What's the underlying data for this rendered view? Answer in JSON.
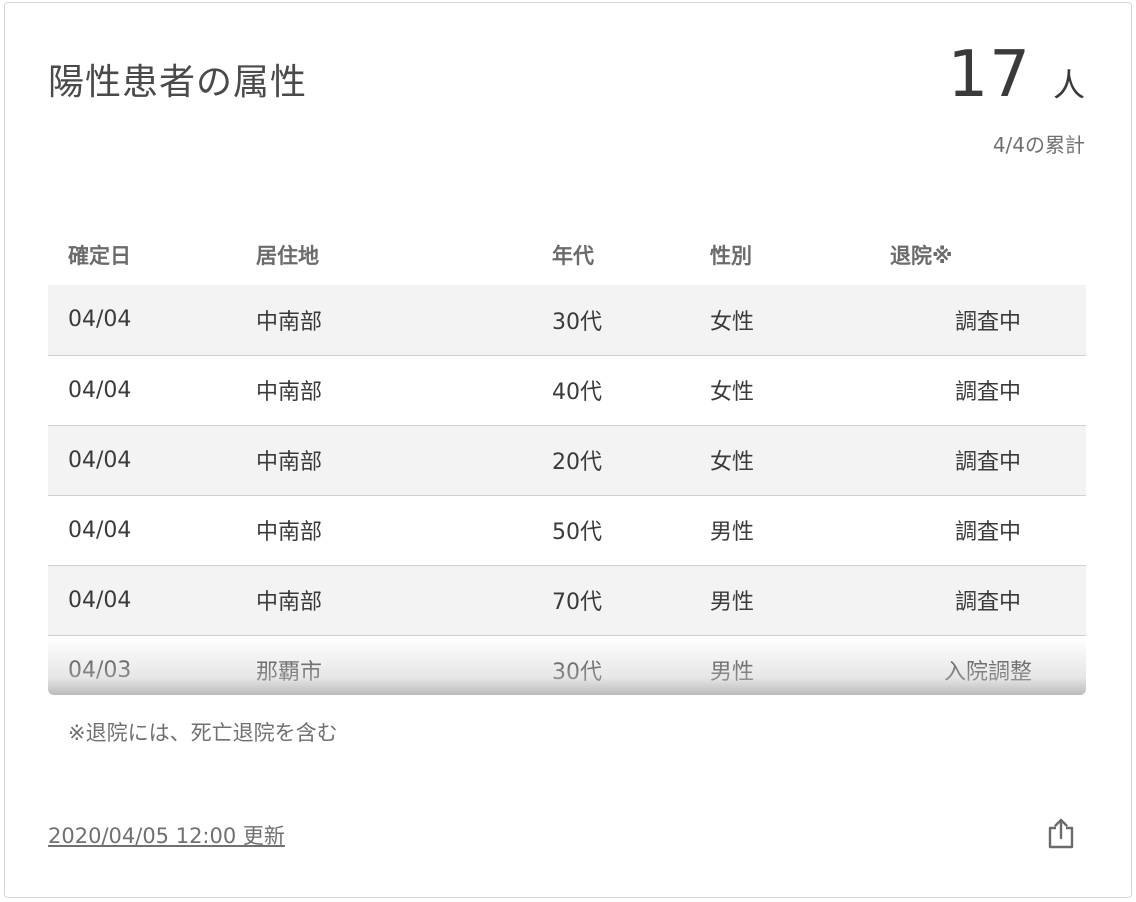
{
  "card": {
    "title": "陽性患者の属性",
    "total_value": "17",
    "total_unit": "人",
    "total_caption": "4/4の累計"
  },
  "table": {
    "headers": [
      "確定日",
      "居住地",
      "年代",
      "性別",
      "退院※"
    ],
    "rows": [
      [
        "04/04",
        "中南部",
        "30代",
        "女性",
        "調査中"
      ],
      [
        "04/04",
        "中南部",
        "40代",
        "女性",
        "調査中"
      ],
      [
        "04/04",
        "中南部",
        "20代",
        "女性",
        "調査中"
      ],
      [
        "04/04",
        "中南部",
        "50代",
        "男性",
        "調査中"
      ],
      [
        "04/04",
        "中南部",
        "70代",
        "男性",
        "調査中"
      ],
      [
        "04/03",
        "那覇市",
        "30代",
        "男性",
        "入院調整"
      ]
    ]
  },
  "footnote": "※退院には、死亡退院を含む",
  "updated": "2020/04/05 12:00 更新",
  "share_icon": "share-icon"
}
